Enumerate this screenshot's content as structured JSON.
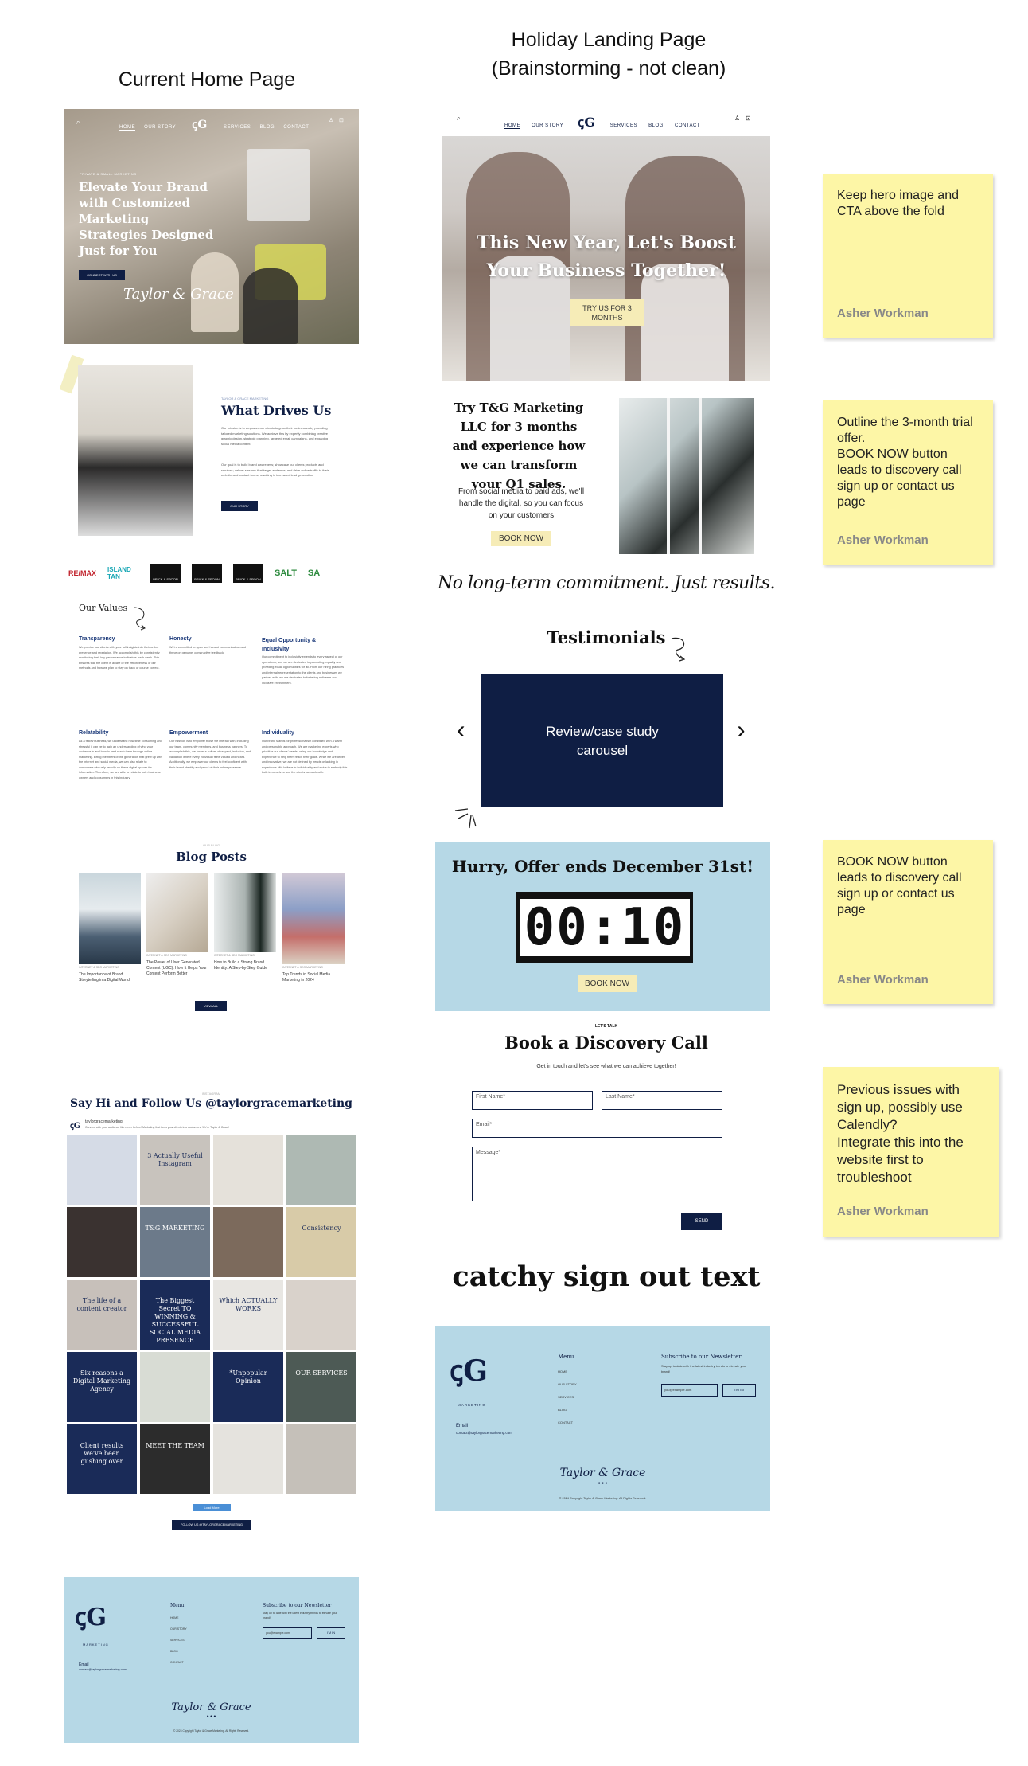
{
  "headings": {
    "left": "Current Home Page",
    "right_line1": "Holiday Landing Page",
    "right_line2": "(Brainstorming - not clean)"
  },
  "current_home": {
    "nav": {
      "home": "HOME",
      "our_story": "OUR STORY",
      "services": "SERVICES",
      "blog": "BLOG",
      "contact": "CONTACT"
    },
    "hero": {
      "kicker": "PRIVATE & SMALL MARKETING",
      "title": "Elevate Your Brand with Customized Marketing Strategies Designed Just for You",
      "button": "CONNECT WITH US",
      "signature": "Taylor & Grace"
    },
    "drives": {
      "kicker": "TAYLOR & GRACE MARKETING",
      "title": "What Drives Us",
      "para1": "Our mission is to empower our clients to grow their businesses by providing tailored marketing solutions. We achieve this by expertly combining creative graphic design, strategic planning, targeted email campaigns, and engaging social media content.",
      "para2": "Our goal is to build brand awareness; showcase our clients products and services; deliver streams that target audience; and drive online traffic to their website and contact forms, resulting in increased lead generation.",
      "button": "OUR STORY"
    },
    "logos": [
      "RE/MAX",
      "ISLAND TAN",
      "BRICK & SPOON",
      "BRICK & SPOON",
      "BRICK & SPOON",
      "SALT",
      "SA"
    ],
    "values": {
      "title": "Our Values",
      "items": [
        {
          "name": "Transparency",
          "text": "We provide our clients with your full insights into their online presence and reputation. We accomplish this by consistently monitoring their key performance indicators each week. This ensures that the client is aware of the effectiveness of our methods and how we plan to stay on track or course correct."
        },
        {
          "name": "Honesty",
          "text": "We're committed to open and honest communication and thrive on genuine, constructive feedback."
        },
        {
          "name": "Equal Opportunity & Inclusivity",
          "text": "Our commitment to inclusivity extends to every aspect of our operations, and we are dedicated to promoting equality and providing equal opportunities for all. From our hiring practices and internal representation to the clients and businesses we partner with, we are dedicated to fostering a diverse and inclusive environment."
        },
        {
          "name": "Relatability",
          "text": "As a fellow business, we understand how time consuming and stressful it can be to gain an understanding of who your audience is and how to best reach them through online marketing. Being members of the generation that grew up with the internet and social media, we can also relate to consumers who rely heavily on these digital spaces for information. Therefore, we are able to relate to both business owners and consumers in this industry."
        },
        {
          "name": "Empowerment",
          "text": "Our mission is to empower those we interact with, including our team, community members, and business partners. To accomplish this, we foster a culture of respect, inclusion, and validation where every individual feels valued and heard. Additionally, we empower our clients to feel confident with their brand identity and proud of their online presence."
        },
        {
          "name": "Individuality",
          "text": "Our brand stands for professionalism combined with a warm and personable approach. We are marketing experts who prioritize our clients' needs, using our knowledge and experience to help them reach their goals. While we are driven and innovative, we are not defined by trends or lacking in experience. We believe in individuality and strive to embody this both in ourselves and the clients we work with."
        }
      ]
    },
    "blog": {
      "kicker": "OUR BLOG",
      "title": "Blog Posts",
      "posts": [
        {
          "tag": "INTERNET & SEO MARKETING",
          "title": "The Importance of Brand Storytelling in a Digital World"
        },
        {
          "tag": "INTERNET & SEO MARKETING",
          "title": "The Power of User Generated Content (UGC): How It Helps Your Content Perform Better"
        },
        {
          "tag": "INTERNET & SEO MARKETING",
          "title": "How to Build a Strong Brand Identity: A Step-by-Step Guide"
        },
        {
          "tag": "INTERNET & SEO MARKETING",
          "title": "Top Trends in Social Media Marketing in 2024"
        }
      ],
      "button": "VIEW ALL"
    },
    "instagram": {
      "kicker": "INSTAGRAM",
      "title": "Say Hi and Follow Us @taylorgracemarketing",
      "handle": "taylorgracemarketing",
      "bio": "Connect with your audience like never before! Marketing that turns your clients into customers. We're Taylor & Grace!",
      "tiles": [
        "",
        "3 Actually Useful Instagram",
        "",
        "",
        "",
        "T&G MARKETING",
        "",
        "Consistency",
        "The life of a content creator",
        "The Biggest Secret TO WINNING & SUCCESSFUL SOCIAL MEDIA PRESENCE",
        "Which ACTUALLY WORKS",
        "",
        "Six reasons a Digital Marketing Agency",
        "",
        "*Unpopular Opinion",
        "OUR SERVICES",
        "Client results we've been gushing over",
        "MEET THE TEAM",
        "",
        ""
      ],
      "load_more": "Load More",
      "follow_button": "FOLLOW US @TAYLORGRACEMARKETING"
    },
    "footer": {
      "brand": "MARKETING",
      "email_label": "Email",
      "email": "contact@taylorgracemarketing.com",
      "menu_title": "Menu",
      "menu": [
        "HOME",
        "OUR STORY",
        "SERVICES",
        "BLOG",
        "CONTACT"
      ],
      "newsletter_title": "Subscribe to our Newsletter",
      "newsletter_text": "Stay up to date with the latest industry trends to elevate your brand!",
      "newsletter_placeholder": "you@example.com",
      "newsletter_button": "I'M IN",
      "signature": "Taylor & Grace",
      "copyright": "© 2024 Copyright Taylor & Grace Marketing. All Rights Reserved."
    }
  },
  "holiday": {
    "nav": {
      "home": "HOME",
      "our_story": "OUR STORY",
      "services": "SERVICES",
      "blog": "BLOG",
      "contact": "CONTACT"
    },
    "hero": {
      "title": "This New Year, Let's Boost Your Business Together!",
      "button": "TRY US FOR 3 MONTHS"
    },
    "trial": {
      "title": "Try T&G Marketing LLC for 3 months and experience how we can transform your Q1 sales.",
      "text": "From social media to paid ads, we'll handle the digital, so you can focus on your customers",
      "button": "BOOK NOW"
    },
    "script_line": "No long-term commitment. Just results.",
    "testimonials": {
      "title": "Testimonials",
      "carousel": "Review/case study carousel"
    },
    "offer": {
      "title": "Hurry, Offer ends December 31st!",
      "timer": "00:10",
      "button": "BOOK NOW"
    },
    "discovery": {
      "kicker": "LET'S TALK",
      "title": "Book a Discovery Call",
      "subtitle": "Get in touch and let's see what we can achieve together!",
      "first_name": "First Name*",
      "last_name": "Last Name*",
      "email": "Email*",
      "message": "Message*",
      "button": "SEND"
    },
    "signout": "catchy sign out text",
    "footer": {
      "brand": "MARKETING",
      "email_label": "Email",
      "email": "contact@taylorgracemarketing.com",
      "menu_title": "Menu",
      "menu": [
        "HOME",
        "OUR STORY",
        "SERVICES",
        "BLOG",
        "CONTACT"
      ],
      "newsletter_title": "Subscribe to our Newsletter",
      "newsletter_text": "Stay up to date with the latest industry trends to elevate your brand!",
      "newsletter_placeholder": "you@example.com",
      "newsletter_button": "I'M IN",
      "signature": "Taylor & Grace",
      "copyright": "© 2024 Copyright Taylor & Grace Marketing. All Rights Reserved."
    }
  },
  "notes": [
    {
      "text": "Keep hero image and CTA above the fold",
      "author": "Asher Workman"
    },
    {
      "text": "Outline the 3-month trial offer.\nBOOK NOW button leads to discovery call sign up or contact us page",
      "author": "Asher Workman"
    },
    {
      "text": "BOOK NOW button leads to discovery call sign up or contact us page",
      "author": "Asher Workman"
    },
    {
      "text": "Previous issues with sign up, possibly use Calendly?\nIntegrate this into the website first to troubleshoot",
      "author": "Asher Workman"
    }
  ],
  "colors": {
    "navy": "#0f1e44",
    "light_blue": "#b6d8e6",
    "note_yellow": "#fdf6a6",
    "cream_button": "#f6ecb7"
  }
}
